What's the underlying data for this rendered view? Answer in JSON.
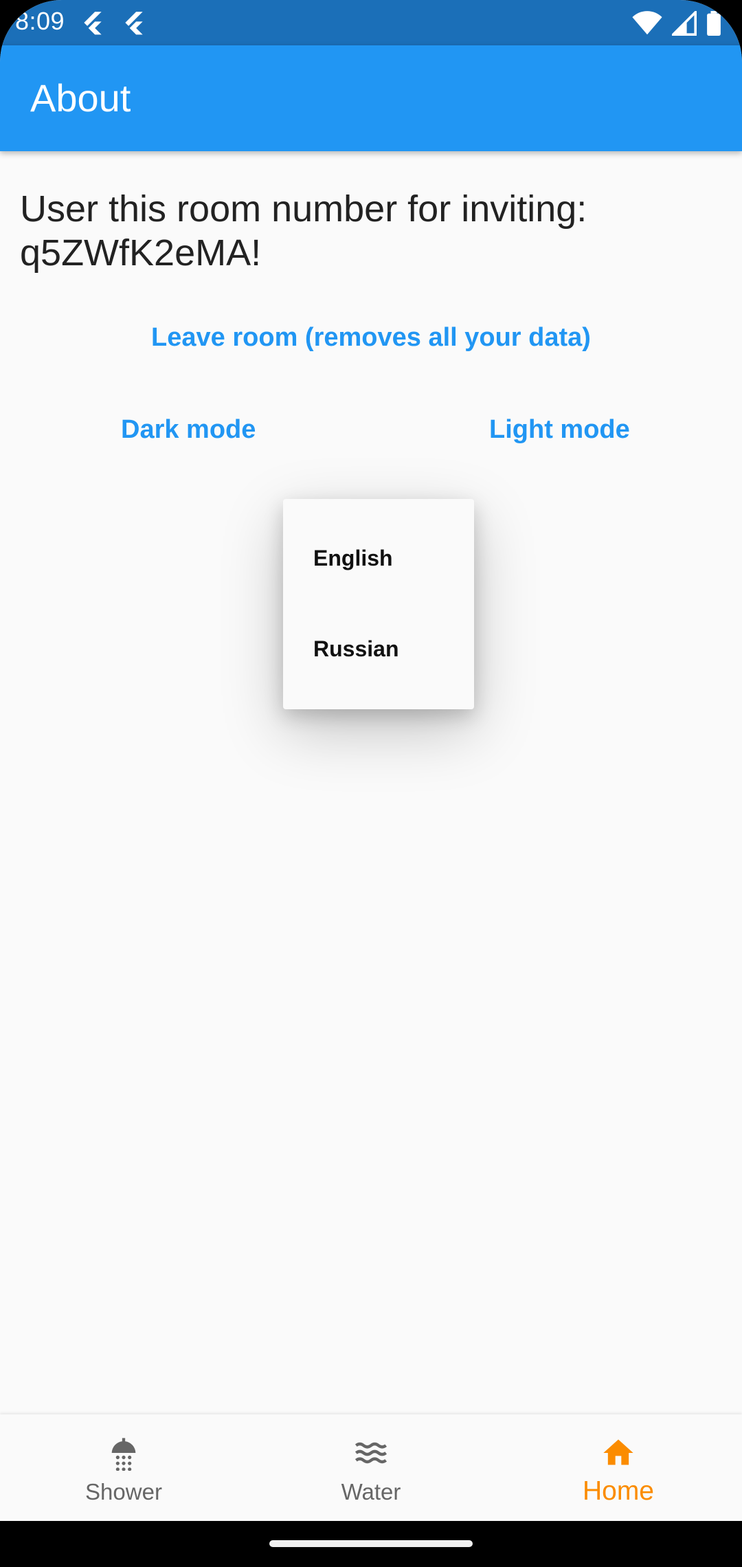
{
  "status_bar": {
    "time": "8:09",
    "icons": [
      "flutter-icon",
      "flutter-icon",
      "wifi-icon",
      "signal-icon",
      "battery-icon"
    ]
  },
  "app_bar": {
    "title": "About"
  },
  "content": {
    "invite_line": "User this room number for inviting:",
    "invite_code": "q5ZWfK2eMA!",
    "leave_button": "Leave room (removes all your data)",
    "dark_mode_button": "Dark mode",
    "light_mode_button": "Light mode"
  },
  "language_menu": {
    "items": [
      {
        "label": "English"
      },
      {
        "label": "Russian"
      }
    ]
  },
  "bottom_nav": {
    "items": [
      {
        "label": "Shower",
        "icon": "shower-icon",
        "active": false
      },
      {
        "label": "Water",
        "icon": "waves-icon",
        "active": false
      },
      {
        "label": "Home",
        "icon": "home-icon",
        "active": true
      }
    ]
  },
  "colors": {
    "primary": "#2196f3",
    "status_bar": "#1b6fb8",
    "active_nav": "#fb8c00",
    "inactive_nav": "#666666",
    "background": "#fafafa"
  }
}
